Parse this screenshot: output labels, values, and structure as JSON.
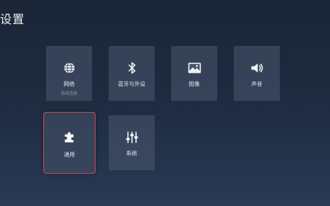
{
  "header": {
    "title": "设置"
  },
  "tiles": [
    {
      "label": "网络",
      "sublabel": "有线连接",
      "icon": "globe-icon"
    },
    {
      "label": "蓝牙与外设",
      "icon": "bluetooth-icon"
    },
    {
      "label": "图像",
      "icon": "image-icon"
    },
    {
      "label": "声音",
      "icon": "speaker-icon"
    },
    {
      "label": "通用",
      "icon": "puzzle-icon",
      "focused": true
    },
    {
      "label": "系统",
      "icon": "sliders-icon"
    }
  ],
  "colors": {
    "focus_border": "#d84a55",
    "tile_bg": "#4a5870"
  }
}
